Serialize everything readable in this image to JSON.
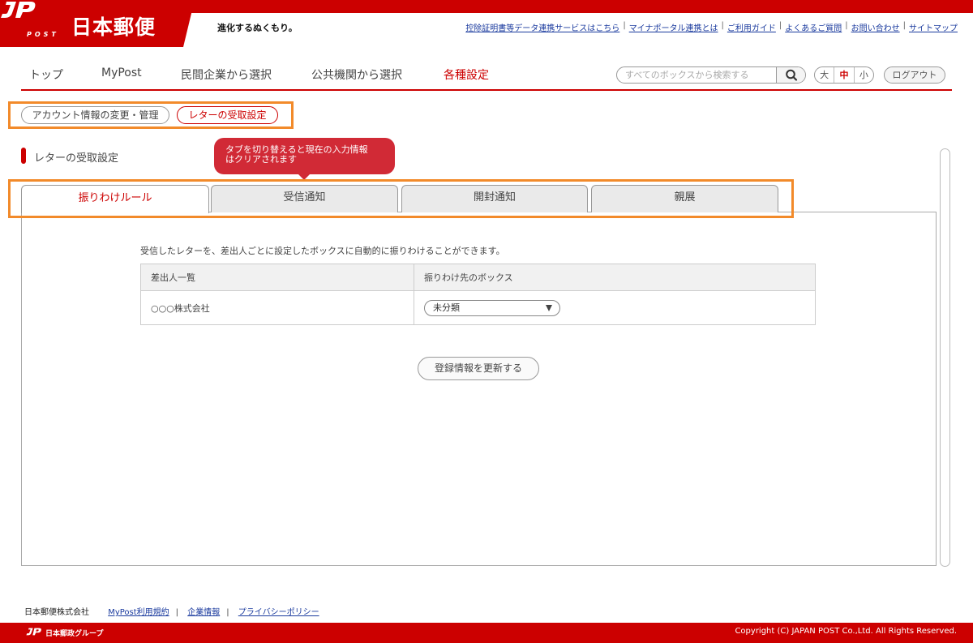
{
  "header": {
    "logo_post": "POST",
    "logo_name": "日本郵便",
    "slogan": "進化するぬくもり。",
    "util_links": [
      "控除証明書等データ連携サービスはこちら",
      "マイナポータル連携とは",
      "ご利用ガイド",
      "よくあるご質問",
      "お問い合わせ",
      "サイトマップ"
    ]
  },
  "nav": {
    "items": [
      "トップ",
      "MyPost",
      "民間企業から選択",
      "公共機関から選択",
      "各種設定"
    ],
    "active_index": 4,
    "search_placeholder": "すべてのボックスから検索する",
    "font_sizes": [
      "大",
      "中",
      "小"
    ],
    "font_size_selected": "中",
    "logout": "ログアウト"
  },
  "subnav": {
    "account_button": "アカウント情報の変更・管理",
    "letter_button": "レターの受取設定"
  },
  "section": {
    "title": "レターの受取設定",
    "tooltip_line1": "タブを切り替えると現在の入力情報",
    "tooltip_line2": "はクリアされます"
  },
  "tabs": [
    "振りわけルール",
    "受信通知",
    "開封通知",
    "親展"
  ],
  "panel": {
    "description": "受信したレターを、差出人ごとに設定したボックスに自動的に振りわけることができます。",
    "columns": [
      "差出人一覧",
      "振りわけ先のボックス"
    ],
    "rows": [
      {
        "sender": "○○○株式会社",
        "box": "未分類"
      }
    ],
    "update_button": "登録情報を更新する"
  },
  "footer": {
    "company": "日本郵便株式会社",
    "links": [
      "MyPost利用規約",
      "企業情報",
      "プライバシーポリシー"
    ],
    "group": "日本郵政グループ",
    "copyright": "Copyright (C) JAPAN POST Co.,Ltd. All Rights Reserved."
  },
  "colors": {
    "brand_red": "#cc0000",
    "highlight_orange": "#f28a2a",
    "tooltip_red": "#d12a36",
    "link_blue": "#1a3a9e"
  }
}
